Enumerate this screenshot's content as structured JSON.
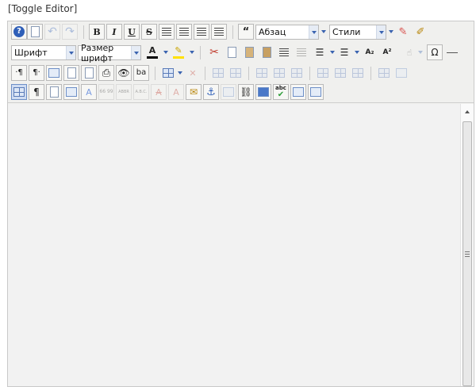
{
  "toggle_link": "[Toggle Editor]",
  "toolbar": {
    "format_select": "Абзац",
    "styles_select": "Стили",
    "font_select": "Шрифт",
    "font_size_select": "Размер шрифт",
    "bold": "B",
    "italic": "I",
    "underline": "U",
    "strike": "S",
    "blockquote": "“",
    "pilcrow_ltr": "·¶",
    "pilcrow_rtl": "¶·",
    "pilcrow": "¶",
    "replace": "ba",
    "text_color_glyph": "A",
    "subscript": "A₂",
    "superscript": "A²",
    "omega": "Ω",
    "abbr": "ABBR",
    "acronym": "A.B.C.",
    "cite": "66 99",
    "spell": "abc",
    "style_glyph": "A"
  },
  "colors": {
    "accent": "#2f5fb8",
    "text_color_bar": "#000000",
    "highlight_bar": "#ffe100"
  }
}
